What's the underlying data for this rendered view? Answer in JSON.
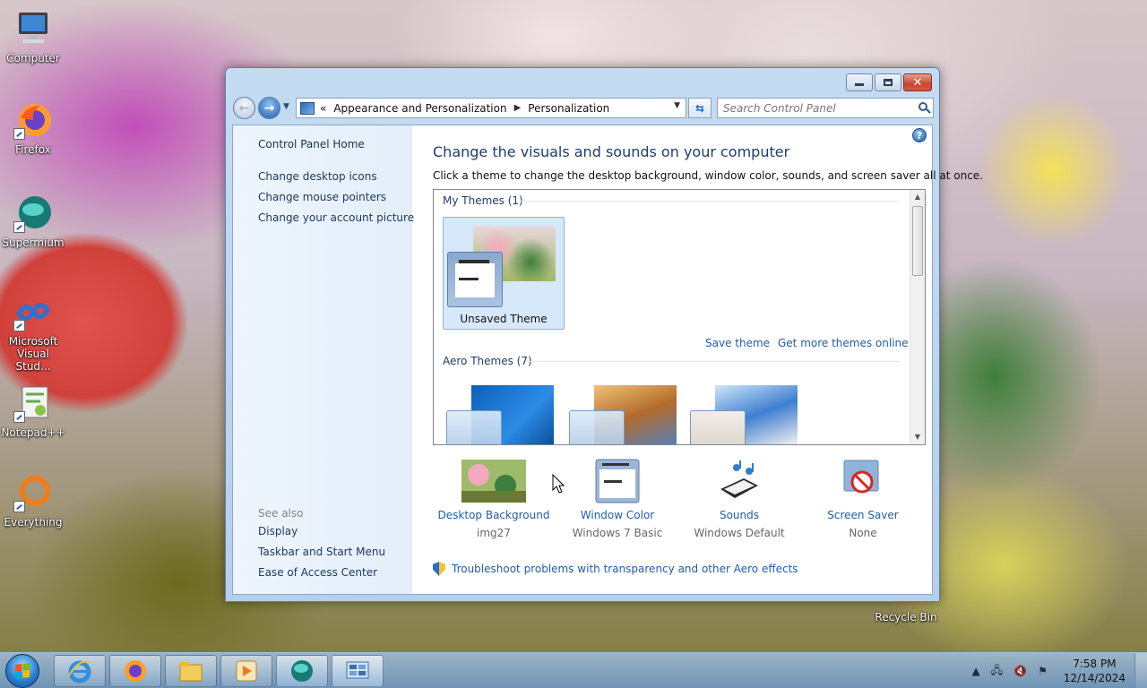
{
  "desktop": {
    "icons": [
      {
        "label": "Computer",
        "icon": "computer-icon"
      },
      {
        "label": "Firefox",
        "icon": "firefox-icon"
      },
      {
        "label": "Supermium",
        "icon": "supermium-icon"
      },
      {
        "label": "Microsoft Visual Stud...",
        "icon": "visual-studio-icon"
      },
      {
        "label": "Notepad++",
        "icon": "notepadpp-icon"
      },
      {
        "label": "Everything",
        "icon": "everything-icon"
      },
      {
        "label": "Recycle Bin",
        "icon": "recycle-bin-icon"
      }
    ]
  },
  "window": {
    "caption_buttons": {
      "minimize": "minimize-icon",
      "maximize": "maximize-icon",
      "close": "close-icon"
    },
    "breadcrumb": {
      "root_glyph": "«",
      "items": [
        "Appearance and Personalization",
        "Personalization"
      ],
      "separator": "▶"
    },
    "search": {
      "placeholder": "Search Control Panel"
    },
    "left_pane": {
      "home": "Control Panel Home",
      "links": [
        "Change desktop icons",
        "Change mouse pointers",
        "Change your account picture"
      ],
      "see_also_header": "See also",
      "see_also": [
        "Display",
        "Taskbar and Start Menu",
        "Ease of Access Center"
      ]
    },
    "main": {
      "title": "Change the visuals and sounds on your computer",
      "subtitle": "Click a theme to change the desktop background, window color, sounds, and screen saver all at once.",
      "help_glyph": "?",
      "themes": {
        "my_themes_header": "My Themes (1)",
        "unsaved_theme_label": "Unsaved Theme",
        "save_theme": "Save theme",
        "get_more_online": "Get more themes online",
        "aero_header": "Aero Themes (7)"
      },
      "tools": [
        {
          "label": "Desktop Background",
          "value": "img27",
          "icon": "desktop-background-icon"
        },
        {
          "label": "Window Color",
          "value": "Windows 7 Basic",
          "icon": "window-color-icon"
        },
        {
          "label": "Sounds",
          "value": "Windows Default",
          "icon": "sounds-icon"
        },
        {
          "label": "Screen Saver",
          "value": "None",
          "icon": "screen-saver-icon"
        }
      ],
      "troubleshoot_link": "Troubleshoot problems with transparency and other Aero effects"
    }
  },
  "taskbar": {
    "pinned": [
      "internet-explorer-icon",
      "firefox-icon",
      "file-explorer-icon",
      "media-player-icon",
      "supermium-icon",
      "control-panel-icon"
    ],
    "clock": {
      "time": "7:58 PM",
      "date": "12/14/2024"
    }
  },
  "colors": {
    "link": "#1f5eae",
    "title": "#1e3e6e",
    "accent": "#2b7fd0"
  }
}
